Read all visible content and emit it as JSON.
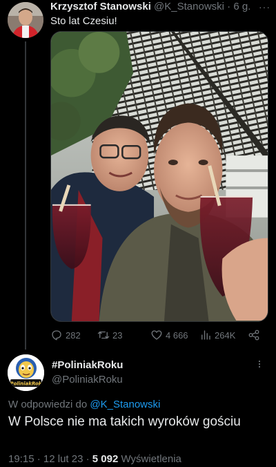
{
  "tweet": {
    "author_name": "Krzysztof Stanowski",
    "author_handle": "@K_Stanowski",
    "separator": "·",
    "time_ago": "6 g.",
    "more": "···",
    "text": "Sto lat Czesiu!",
    "actions": {
      "replies": "282",
      "retweets": "23",
      "likes": "4 666",
      "views": "264K"
    }
  },
  "reply": {
    "author_name": "#PoliniakRoku",
    "author_handle": "@PoliniakRoku",
    "avatar_text": "#PoliniakRoku",
    "more": "···",
    "reply_prefix": "W odpowiedzi do",
    "reply_mention": "@K_Stanowski",
    "text": "W Polsce nie ma takich wyroków gościu",
    "time": "19:15",
    "dot": "·",
    "date": "12 lut 23",
    "views_count": "5 092",
    "views_label": "Wyświetlenia"
  },
  "colors": {
    "background": "#000000",
    "text_primary": "#e7e9ea",
    "text_secondary": "#71767b",
    "accent": "#1d9bf0",
    "divider": "#333639"
  },
  "icons": [
    "reply-icon",
    "retweet-icon",
    "like-icon",
    "views-icon",
    "share-icon",
    "more-icon"
  ]
}
